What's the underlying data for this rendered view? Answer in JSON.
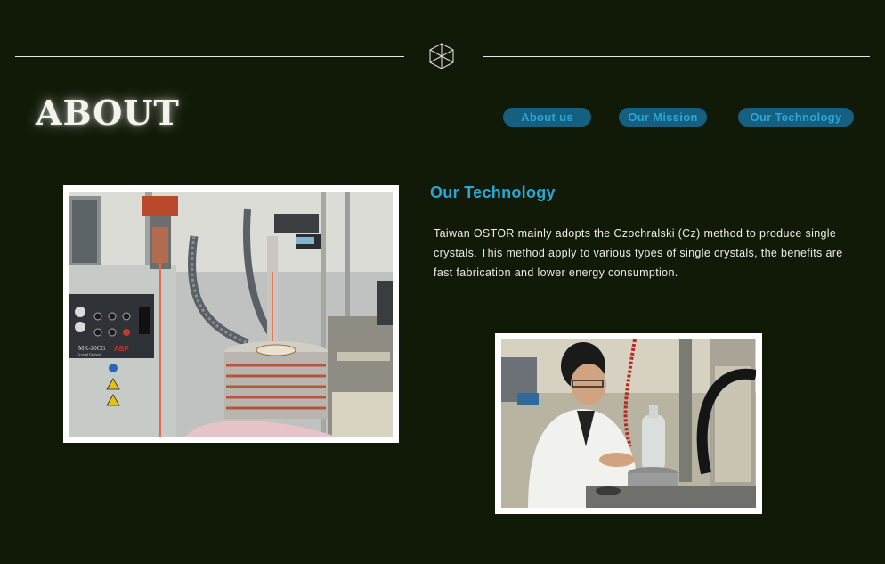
{
  "header": {
    "page_title": "ABOUT"
  },
  "nav": {
    "items": [
      {
        "label": "About us"
      },
      {
        "label": "Our Mission"
      },
      {
        "label": "Our Technology"
      }
    ]
  },
  "content": {
    "heading": "Our Technology",
    "paragraph": "Taiwan OSTOR  mainly adopts the Czochralski (Cz) method to produce single crystals.  This method apply to various types of single crystals, the benefits are fast fabrication and lower energy consumption."
  },
  "photo_labels": {
    "machine_model": "MK-20CG",
    "machine_caption": "Crystal Grower",
    "brand": "ABP"
  },
  "colors": {
    "background": "#111a07",
    "accent": "#2aa6d6",
    "nav_button_bg": "#155f80"
  }
}
